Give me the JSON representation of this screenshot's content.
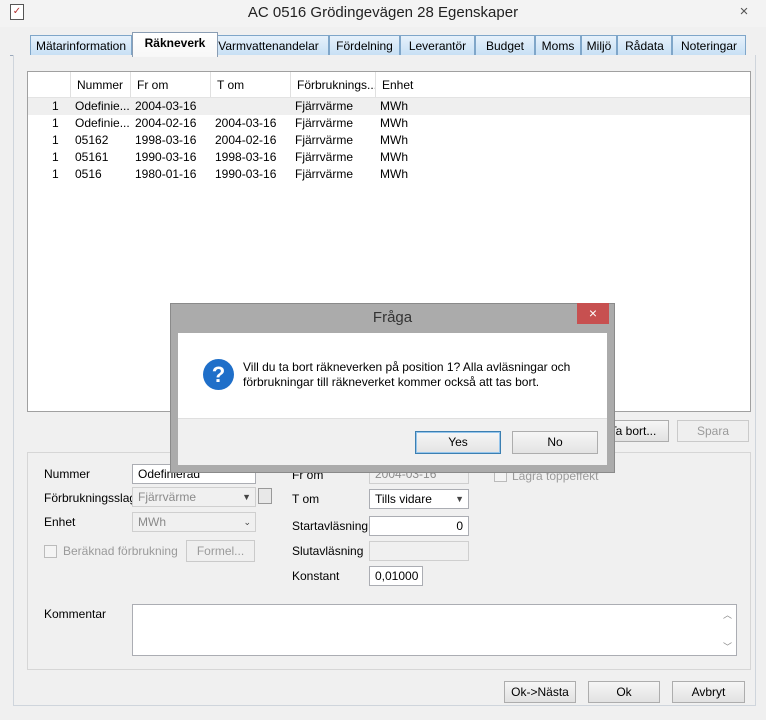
{
  "window": {
    "title": "AC 0516 Grödingevägen 28 Egenskaper",
    "close_glyph": "×"
  },
  "tabs": [
    {
      "label": "Mätarinformation",
      "active": false
    },
    {
      "label": "Räkneverk",
      "active": true
    },
    {
      "label": "Varmvattenandelar",
      "active": false
    },
    {
      "label": "Fördelning",
      "active": false
    },
    {
      "label": "Leverantör",
      "active": false
    },
    {
      "label": "Budget",
      "active": false
    },
    {
      "label": "Moms",
      "active": false
    },
    {
      "label": "Miljö",
      "active": false
    },
    {
      "label": "Rådata",
      "active": false
    },
    {
      "label": "Noteringar",
      "active": false
    }
  ],
  "grid": {
    "columns": [
      "",
      "Nummer",
      "Fr om",
      "T om",
      "Förbruknings...",
      "Enhet"
    ],
    "rows": [
      [
        "1",
        "Odefinie...",
        "2004-03-16",
        "",
        "Fjärrvärme",
        "MWh"
      ],
      [
        "1",
        "Odefinie...",
        "2004-02-16",
        "2004-03-16",
        "Fjärrvärme",
        "MWh"
      ],
      [
        "1",
        "05162",
        "1998-03-16",
        "2004-02-16",
        "Fjärrvärme",
        "MWh"
      ],
      [
        "1",
        "05161",
        "1990-03-16",
        "1998-03-16",
        "Fjärrvärme",
        "MWh"
      ],
      [
        "1",
        "0516",
        "1980-01-16",
        "1990-03-16",
        "Fjärrvärme",
        "MWh"
      ]
    ]
  },
  "grid_buttons": {
    "remove_label": "Ta bort...",
    "save_label": "Spara"
  },
  "form": {
    "nummer_label": "Nummer",
    "nummer_value": "Odefinierad",
    "forbrukningsslag_label": "Förbrukningsslag",
    "forbrukningsslag_value": "Fjärrvärme",
    "enhet_label": "Enhet",
    "enhet_value": "MWh",
    "beraknad_label": "Beräknad förbrukning",
    "formel_label": "Formel...",
    "from_label": "Fr om",
    "from_value": "2004-03-16",
    "tom_label": "T om",
    "tom_value": "Tills vidare",
    "startavlasning_label": "Startavläsning",
    "startavlasning_value": "0",
    "slutavlasning_label": "Slutavläsning",
    "slutavlasning_value": "",
    "konstant_label": "Konstant",
    "konstant_value": "0,01000",
    "lagra_label": "Lagra toppeffekt",
    "kommentar_label": "Kommentar"
  },
  "footer": {
    "next_label": "Ok->Nästa",
    "ok_label": "Ok",
    "cancel_label": "Avbryt"
  },
  "dialog": {
    "title": "Fråga",
    "close_glyph": "×",
    "icon_glyph": "?",
    "message": "Vill du ta bort räkneverken på position 1? Alla avläsningar och förbrukningar till räkneverket kommer också att tas bort.",
    "yes_label": "Yes",
    "no_label": "No"
  }
}
